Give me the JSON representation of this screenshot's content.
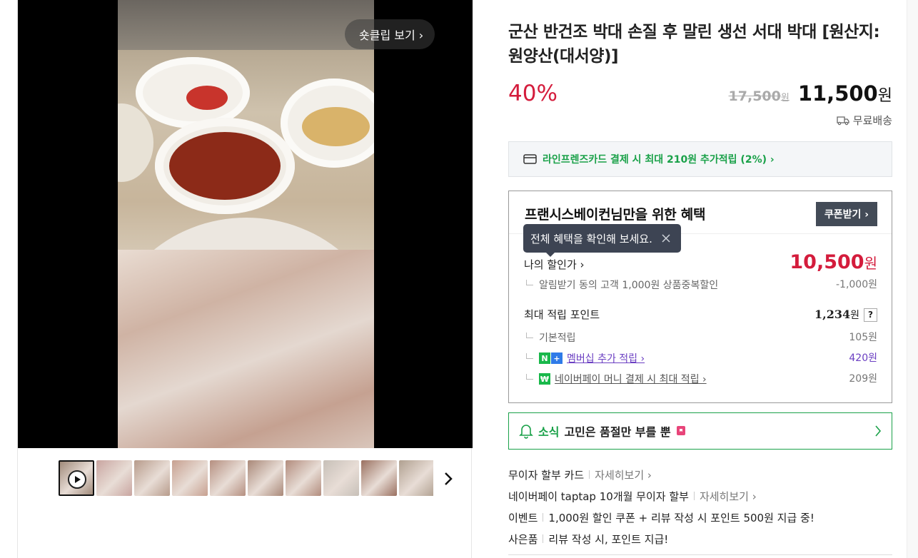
{
  "media": {
    "shortclip_label": "숏클립 보기 ›",
    "thumbnails": [
      {
        "kind": "video",
        "color": "#a08a7a"
      },
      {
        "kind": "image",
        "color": "#c9a5a0"
      },
      {
        "kind": "image",
        "color": "#b79b8b"
      },
      {
        "kind": "image",
        "color": "#c7a090"
      },
      {
        "kind": "image",
        "color": "#b58f80"
      },
      {
        "kind": "image",
        "color": "#a98878"
      },
      {
        "kind": "image",
        "color": "#b28c7d"
      },
      {
        "kind": "image",
        "color": "#c7c0b8"
      },
      {
        "kind": "image",
        "color": "#9a7060"
      },
      {
        "kind": "image",
        "color": "#b0a090"
      }
    ]
  },
  "product": {
    "title": "군산 반건조 박대 손질 후 말린 생선 서대 박대 [원산지:원양산(대서양)]",
    "discount": "40%",
    "original_price": "17,500",
    "original_unit": "원",
    "sale_price": "11,500",
    "sale_unit": "원",
    "shipping": "무료배송"
  },
  "card_promo": "라인프렌즈카드 결제 시 최대 210원 추가적립 (2%) ›",
  "benefit": {
    "title": "프랜시스베이컨님만을 위한 혜택",
    "coupon_button": "쿠폰받기 ›",
    "tooltip": "전체 혜택을 확인해 보세요.",
    "my_price_label": "나의 할인가 ›",
    "my_price": "10,500",
    "my_price_unit": "원",
    "alarm_discount_label": "알림받기 동의 고객 1,000원 상품중복할인",
    "alarm_discount_value": "-1,000원",
    "max_points_label": "최대 적립 포인트",
    "max_points": "1,234",
    "max_points_unit": "원",
    "help": "?",
    "base_points_label": "기본적립",
    "base_points_value": "105원",
    "membership_label": "멤버십 추가 적립 ›",
    "membership_value": "420원",
    "npay_label": "네이버페이 머니 결제 시 최대 적립 ›",
    "npay_value": "209원",
    "badge_n": "N",
    "badge_plus": "+",
    "badge_pay": "₩"
  },
  "notice": {
    "tag": "소식",
    "message": "고민은 품절만 부를 뿐"
  },
  "info_lines": [
    {
      "label": "무이자 할부 카드",
      "detail": "자세히보기 ›"
    },
    {
      "label": "네이버페이 taptap 10개월 무이자 할부",
      "detail": "자세히보기 ›"
    },
    {
      "label": "이벤트",
      "detail": "1,000원 할인 쿠폰 + 리뷰 작성 시 포인트 500원 지급 중!"
    },
    {
      "label": "사은품",
      "detail": "리뷰 작성 시, 포인트 지급!"
    }
  ],
  "colors": {
    "accent_red": "#d41c3c",
    "naver_green": "#1aa149",
    "purple_link": "#6b3fc2"
  }
}
